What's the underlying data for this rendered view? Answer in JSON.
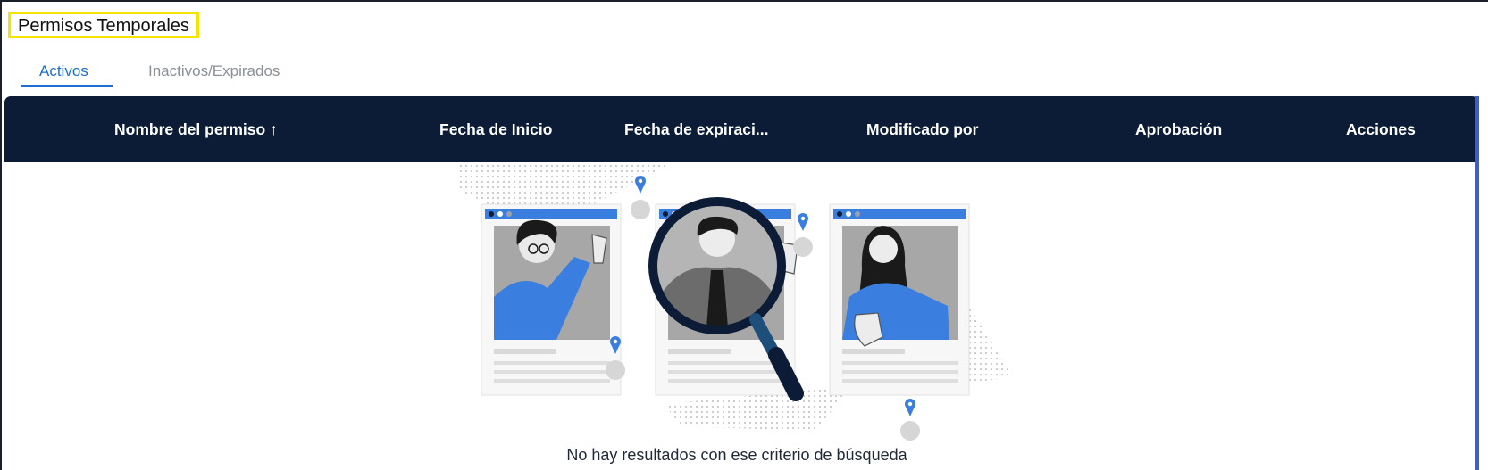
{
  "page": {
    "title": "Permisos Temporales"
  },
  "tabs": [
    {
      "label": "Activos",
      "active": true
    },
    {
      "label": "Inactivos/Expirados",
      "active": false
    }
  ],
  "table": {
    "columns": [
      {
        "label": "Nombre del permiso",
        "sort": "ascending",
        "sort_icon": "arrow-up-icon",
        "sort_glyph": "↑"
      },
      {
        "label": "Fecha de Inicio"
      },
      {
        "label": "Fecha de expiraci..."
      },
      {
        "label": "Modificado por"
      },
      {
        "label": "Aprobación"
      },
      {
        "label": "Acciones"
      }
    ],
    "rows": []
  },
  "empty_state": {
    "message": "No hay resultados con ese criterio de búsqueda",
    "illustration": "people-search-magnifier-illustration"
  },
  "colors": {
    "header_bg": "#0c1c37",
    "accent": "#1e6fd4",
    "illustration_blue": "#3a7fe0",
    "title_highlight": "#f5e400",
    "scrollbar": "#3e5ec8"
  }
}
